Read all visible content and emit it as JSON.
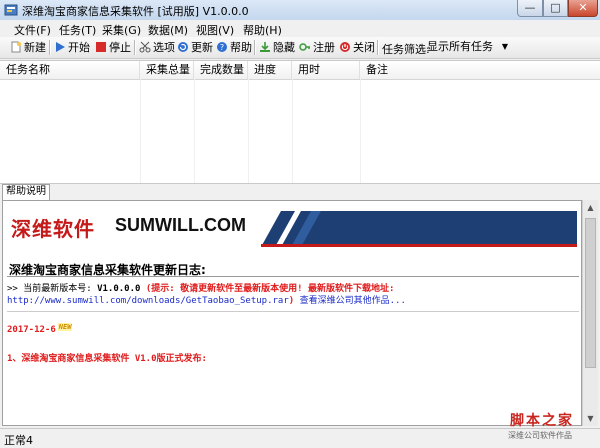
{
  "window": {
    "title": "深维淘宝商家信息采集软件 [试用版] V1.0.0.0",
    "controls": {
      "minimize": "—",
      "maximize": "□",
      "close": "✕"
    }
  },
  "menu": [
    "文件(F)",
    "任务(T)",
    "采集(G)",
    "数据(M)",
    "视图(V)",
    "帮助(H)"
  ],
  "toolbar": {
    "buttons": [
      {
        "label": "新建",
        "icon": "new-document-icon",
        "color": "#f2c94c"
      },
      {
        "label": "开始",
        "icon": "play-icon",
        "color": "#2f6fd1"
      },
      {
        "label": "停止",
        "icon": "stop-icon",
        "color": "#d62b2b"
      },
      {
        "label": "选项",
        "icon": "scissors-icon",
        "color": "#666666"
      },
      {
        "label": "更新",
        "icon": "refresh-icon",
        "color": "#2f6fd1"
      },
      {
        "label": "帮助",
        "icon": "help-icon",
        "color": "#2f6fd1"
      },
      {
        "label": "隐藏",
        "icon": "download-icon",
        "color": "#3a9a3a"
      },
      {
        "label": "注册",
        "icon": "key-icon",
        "color": "#3a9a3a"
      },
      {
        "label": "关闭",
        "icon": "power-icon",
        "color": "#d62b2b"
      }
    ],
    "filter_label": "任务筛选:",
    "filter_value": "显示所有任务"
  },
  "task_list": {
    "columns": [
      "任务名称",
      "采集总量",
      "完成数量",
      "进度",
      "用时",
      "备注"
    ]
  },
  "help_tab": {
    "label": "帮助说明"
  },
  "doc": {
    "logo_cn": "深维软件",
    "logo_en": "SUMWILL.COM",
    "title": "深维淘宝商家信息采集软件更新日志:",
    "version_line_prefix": ">> 当前最新版本号: ",
    "version": "V1.0.0.0",
    "tip": "(提示: 敬请更新软件至最新版本使用! 最新版软件下载地址:",
    "download_url": "http://www.sumwill.com/downloads/GetTaobao_Setup.rar",
    "close_paren": ")",
    "other_works": "查看深维公司其他作品...",
    "date": "2017-12-6",
    "new_badge": "NEW",
    "release_note": "1、深维淘宝商家信息采集软件 V1.0版正式发布:"
  },
  "status": {
    "text": "正常4"
  },
  "watermark": {
    "cn": "脚本之家",
    "sub": "深维公司软件作品"
  },
  "colors": {
    "accent_red": "#e01b1b",
    "link_blue": "#1a2bc8",
    "brand_red": "#c41a1a"
  }
}
